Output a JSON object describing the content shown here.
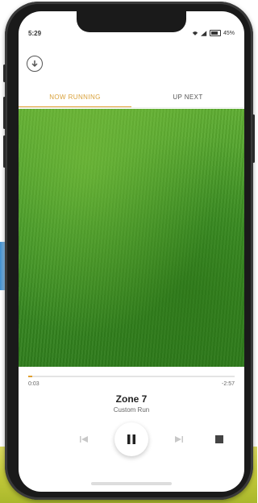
{
  "status": {
    "time": "5:29",
    "battery": "45%"
  },
  "tabs": [
    {
      "label": "NOW RUNNING",
      "active": true
    },
    {
      "label": "UP NEXT",
      "active": false
    }
  ],
  "player": {
    "progress": 0.02,
    "elapsed": "0:03",
    "remaining": "-2:57",
    "zone_name": "Zone 7",
    "zone_subtitle": "Custom Run"
  },
  "colors": {
    "accent": "#e0a030",
    "lawn": "#3f9426"
  },
  "icons": [
    "back-arrow-icon",
    "wifi-icon",
    "signal-icon",
    "battery-icon",
    "previous-icon",
    "pause-icon",
    "next-icon",
    "stop-icon"
  ]
}
